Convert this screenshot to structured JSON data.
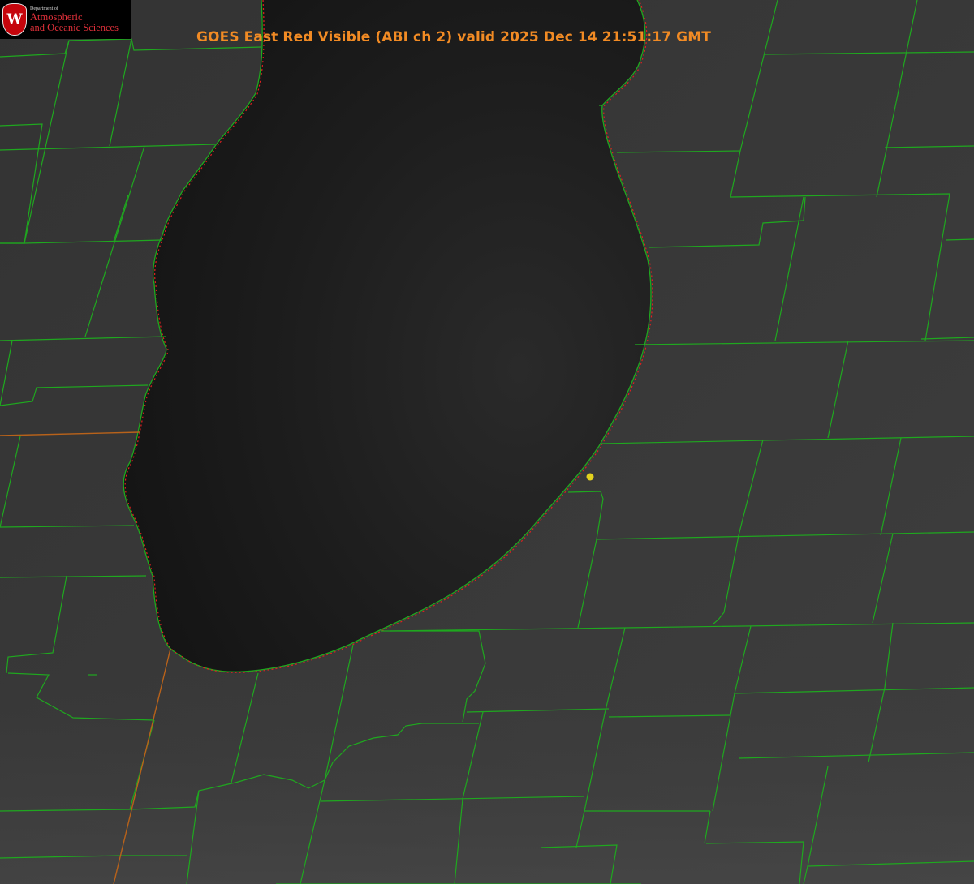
{
  "title": "GOES East Red Visible (ABI ch 2) valid 2025 Dec 14 21:51:17 GMT",
  "logo": {
    "crest_letter": "W",
    "department": "Department of",
    "line1": "Atmospheric",
    "line2": "and Oceanic Sciences",
    "crest_color": "#c5050c",
    "text_color": "#e0303a"
  },
  "colors": {
    "title": "#f28b24",
    "county_border": "#1fa81f",
    "shoreline_dotted": "#e02020",
    "state_border": "#b8621a",
    "marker": "#e3d21e",
    "lake": "#161616",
    "land": "#3a3a3a"
  },
  "map": {
    "product": "visible-satellite-image",
    "features": [
      "lake",
      "county-borders",
      "state-border",
      "shoreline",
      "point-marker"
    ]
  }
}
